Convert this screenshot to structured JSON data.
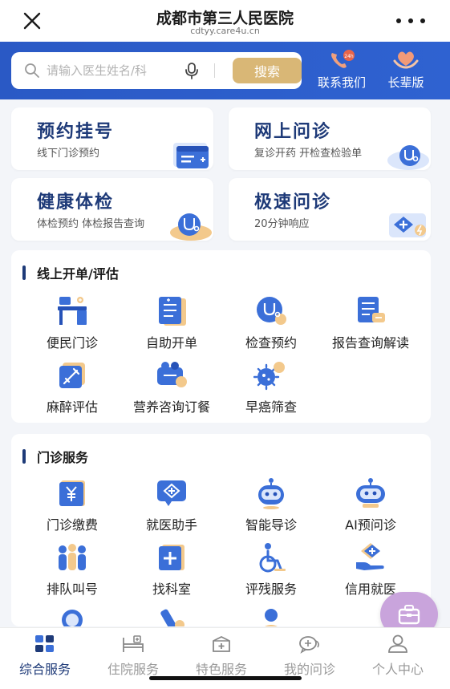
{
  "header": {
    "title": "成都市第三人民医院",
    "subtitle": "cdtyy.care4u.cn",
    "close_icon": "close-icon",
    "more_icon": "more-dots-icon"
  },
  "search": {
    "placeholder": "请输入医生姓名/科",
    "button_label": "搜索"
  },
  "top_links": [
    {
      "label": "联系我们",
      "icon": "phone-24h-icon"
    },
    {
      "label": "长辈版",
      "icon": "heart-hands-icon"
    }
  ],
  "cards": [
    {
      "title": "预约挂号",
      "subtitle": "线下门诊预约",
      "icon": "calendar-icon"
    },
    {
      "title": "网上问诊",
      "subtitle": "复诊开药 开检查检验单",
      "icon": "stethoscope-icon"
    },
    {
      "title": "健康体检",
      "subtitle": "体检预约 体检报告查询",
      "icon": "stethoscope-icon"
    },
    {
      "title": "极速问诊",
      "subtitle": "20分钟响应",
      "icon": "medical-lightning-icon"
    }
  ],
  "section_online": {
    "title": "线上开单/评估",
    "items": [
      {
        "label": "便民门诊",
        "icon": "clinic-desk-icon"
      },
      {
        "label": "自助开单",
        "icon": "form-list-icon"
      },
      {
        "label": "检查预约",
        "icon": "stethoscope-icon"
      },
      {
        "label": "报告查询解读",
        "icon": "report-icon"
      },
      {
        "label": "麻醉评估",
        "icon": "syringe-icon"
      },
      {
        "label": "营养咨询订餐",
        "icon": "nutrition-icon"
      },
      {
        "label": "早癌筛查",
        "icon": "virus-icon"
      }
    ]
  },
  "section_outpatient": {
    "title": "门诊服务",
    "items": [
      {
        "label": "门诊缴费",
        "icon": "yen-payment-icon"
      },
      {
        "label": "就医助手",
        "icon": "medical-chat-icon"
      },
      {
        "label": "智能导诊",
        "icon": "robot-icon"
      },
      {
        "label": "AI预问诊",
        "icon": "ai-robot-icon"
      },
      {
        "label": "排队叫号",
        "icon": "queue-people-icon"
      },
      {
        "label": "找科室",
        "icon": "hospital-cross-icon"
      },
      {
        "label": "评残服务",
        "icon": "wheelchair-icon"
      },
      {
        "label": "信用就医",
        "icon": "credit-hand-icon"
      }
    ]
  },
  "fab": {
    "icon": "medical-kit-icon"
  },
  "tabs": [
    {
      "label": "综合服务",
      "icon": "grid-icon",
      "active": true
    },
    {
      "label": "住院服务",
      "icon": "hospital-bed-icon",
      "active": false
    },
    {
      "label": "特色服务",
      "icon": "medical-box-icon",
      "active": false
    },
    {
      "label": "我的问诊",
      "icon": "chat-bubble-icon",
      "active": false
    },
    {
      "label": "个人中心",
      "icon": "person-icon",
      "active": false
    }
  ],
  "colors": {
    "brand_blue": "#2a59c5",
    "navy_text": "#1e3a78",
    "gold_button": "#d9b776",
    "fab_purple": "#c9a4dc"
  }
}
